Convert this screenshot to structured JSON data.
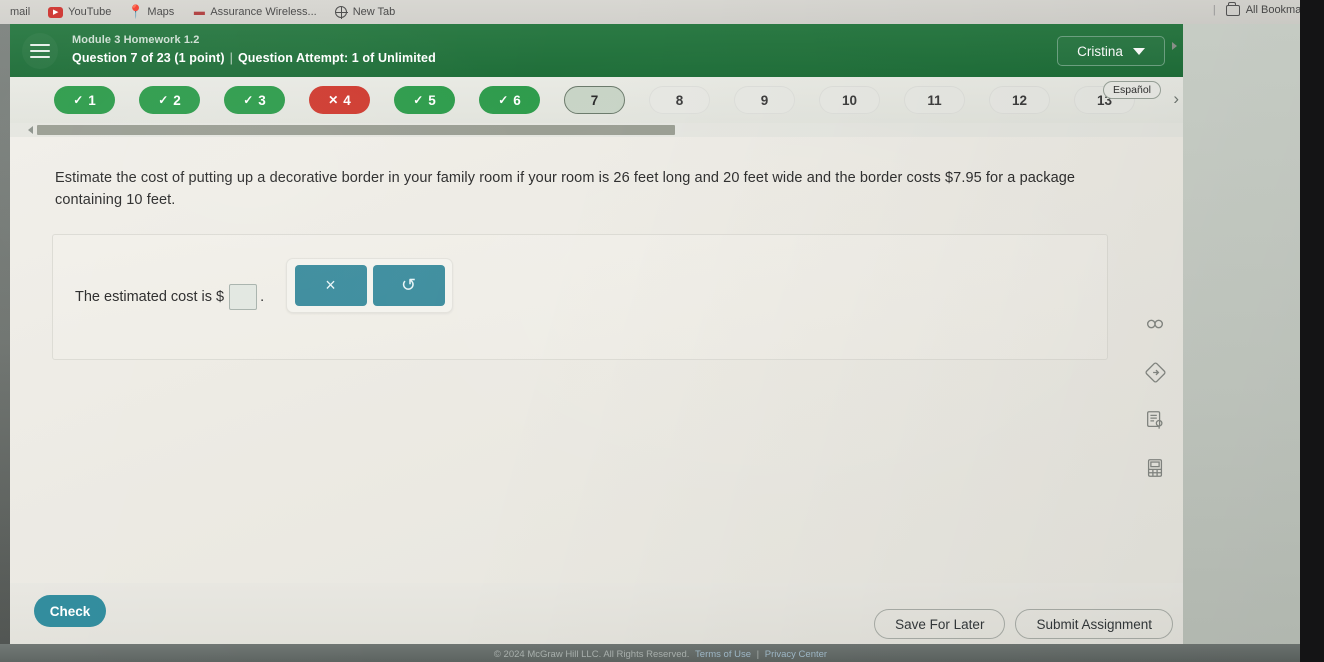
{
  "browser": {
    "bookmarks": [
      {
        "label": "mail",
        "icon": "mail-icon"
      },
      {
        "label": "YouTube",
        "icon": "youtube-icon"
      },
      {
        "label": "Maps",
        "icon": "maps-pin-icon"
      },
      {
        "label": "Assurance Wireless...",
        "icon": "dash-icon"
      },
      {
        "label": "New Tab",
        "icon": "globe-icon"
      }
    ],
    "all_bookmarks_label": "All Bookmarks"
  },
  "header": {
    "course_title": "Module 3 Homework 1.2",
    "question_meta_left": "Question 7 of 23 (1 point)",
    "separator": "|",
    "question_meta_right": "Question Attempt: 1 of Unlimited",
    "user_name": "Cristina",
    "menu_icon": "hamburger-icon",
    "brand_green": "#20703a"
  },
  "pills": {
    "items": [
      {
        "number": "1",
        "state": "correct",
        "mark": "✓"
      },
      {
        "number": "2",
        "state": "correct",
        "mark": "✓"
      },
      {
        "number": "3",
        "state": "correct",
        "mark": "✓"
      },
      {
        "number": "4",
        "state": "wrong",
        "mark": "✕"
      },
      {
        "number": "5",
        "state": "correct",
        "mark": "✓"
      },
      {
        "number": "6",
        "state": "correct",
        "mark": "✓"
      },
      {
        "number": "7",
        "state": "active",
        "mark": ""
      },
      {
        "number": "8",
        "state": "plain",
        "mark": ""
      },
      {
        "number": "9",
        "state": "plain",
        "mark": ""
      },
      {
        "number": "10",
        "state": "plain",
        "mark": ""
      },
      {
        "number": "11",
        "state": "plain",
        "mark": ""
      },
      {
        "number": "12",
        "state": "plain",
        "mark": ""
      },
      {
        "number": "13",
        "state": "plain",
        "mark": ""
      }
    ],
    "espanol_label": "Español",
    "next_arrow": "›",
    "prev_arrow": "‹",
    "correct_color": "#2e9c4c",
    "wrong_color": "#cf3c31"
  },
  "question": {
    "text": "Estimate the cost of putting up a decorative border in your family room if your room is 26 feet long and 20 feet wide and the border costs $7.95 for a package containing 10 feet."
  },
  "answer": {
    "prefix": "The estimated cost is  $",
    "suffix": ".",
    "input_value": "",
    "input_placeholder": "",
    "tools": [
      {
        "name": "clear-button",
        "glyph": "×"
      },
      {
        "name": "undo-button",
        "glyph": "↺"
      }
    ],
    "tool_color": "#3d8d9e"
  },
  "rail": {
    "icons": [
      {
        "name": "infinity-icon",
        "glyph": "∞"
      },
      {
        "name": "diamond-arrow-icon",
        "glyph": "◇"
      },
      {
        "name": "reference-note-icon",
        "glyph": "☰"
      },
      {
        "name": "calculator-icon",
        "glyph": "⊞"
      }
    ]
  },
  "actions": {
    "check_label": "Check",
    "save_label": "Save For Later",
    "submit_label": "Submit Assignment",
    "check_color": "#2f8b9c"
  },
  "footer": {
    "copyright": "© 2024 McGraw Hill LLC. All Rights Reserved.",
    "terms": "Terms of Use",
    "divider": "|",
    "privacy": "Privacy Center"
  }
}
